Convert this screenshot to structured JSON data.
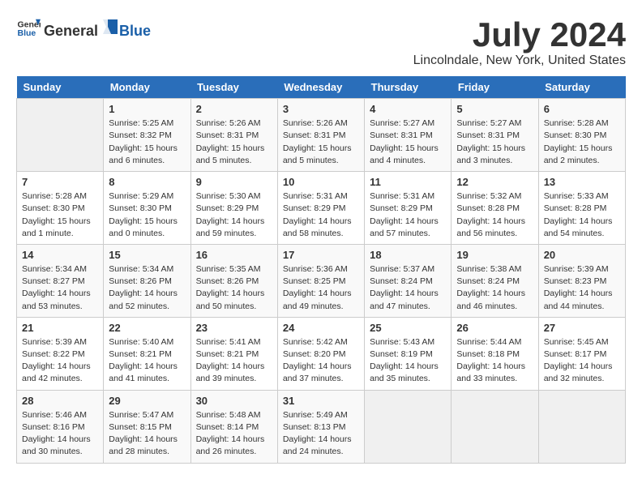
{
  "header": {
    "logo_general": "General",
    "logo_blue": "Blue",
    "main_title": "July 2024",
    "subtitle": "Lincolndale, New York, United States"
  },
  "days_of_week": [
    "Sunday",
    "Monday",
    "Tuesday",
    "Wednesday",
    "Thursday",
    "Friday",
    "Saturday"
  ],
  "weeks": [
    [
      {
        "day": "",
        "info": ""
      },
      {
        "day": "1",
        "info": "Sunrise: 5:25 AM\nSunset: 8:32 PM\nDaylight: 15 hours\nand 6 minutes."
      },
      {
        "day": "2",
        "info": "Sunrise: 5:26 AM\nSunset: 8:31 PM\nDaylight: 15 hours\nand 5 minutes."
      },
      {
        "day": "3",
        "info": "Sunrise: 5:26 AM\nSunset: 8:31 PM\nDaylight: 15 hours\nand 5 minutes."
      },
      {
        "day": "4",
        "info": "Sunrise: 5:27 AM\nSunset: 8:31 PM\nDaylight: 15 hours\nand 4 minutes."
      },
      {
        "day": "5",
        "info": "Sunrise: 5:27 AM\nSunset: 8:31 PM\nDaylight: 15 hours\nand 3 minutes."
      },
      {
        "day": "6",
        "info": "Sunrise: 5:28 AM\nSunset: 8:30 PM\nDaylight: 15 hours\nand 2 minutes."
      }
    ],
    [
      {
        "day": "7",
        "info": "Sunrise: 5:28 AM\nSunset: 8:30 PM\nDaylight: 15 hours\nand 1 minute."
      },
      {
        "day": "8",
        "info": "Sunrise: 5:29 AM\nSunset: 8:30 PM\nDaylight: 15 hours\nand 0 minutes."
      },
      {
        "day": "9",
        "info": "Sunrise: 5:30 AM\nSunset: 8:29 PM\nDaylight: 14 hours\nand 59 minutes."
      },
      {
        "day": "10",
        "info": "Sunrise: 5:31 AM\nSunset: 8:29 PM\nDaylight: 14 hours\nand 58 minutes."
      },
      {
        "day": "11",
        "info": "Sunrise: 5:31 AM\nSunset: 8:29 PM\nDaylight: 14 hours\nand 57 minutes."
      },
      {
        "day": "12",
        "info": "Sunrise: 5:32 AM\nSunset: 8:28 PM\nDaylight: 14 hours\nand 56 minutes."
      },
      {
        "day": "13",
        "info": "Sunrise: 5:33 AM\nSunset: 8:28 PM\nDaylight: 14 hours\nand 54 minutes."
      }
    ],
    [
      {
        "day": "14",
        "info": "Sunrise: 5:34 AM\nSunset: 8:27 PM\nDaylight: 14 hours\nand 53 minutes."
      },
      {
        "day": "15",
        "info": "Sunrise: 5:34 AM\nSunset: 8:26 PM\nDaylight: 14 hours\nand 52 minutes."
      },
      {
        "day": "16",
        "info": "Sunrise: 5:35 AM\nSunset: 8:26 PM\nDaylight: 14 hours\nand 50 minutes."
      },
      {
        "day": "17",
        "info": "Sunrise: 5:36 AM\nSunset: 8:25 PM\nDaylight: 14 hours\nand 49 minutes."
      },
      {
        "day": "18",
        "info": "Sunrise: 5:37 AM\nSunset: 8:24 PM\nDaylight: 14 hours\nand 47 minutes."
      },
      {
        "day": "19",
        "info": "Sunrise: 5:38 AM\nSunset: 8:24 PM\nDaylight: 14 hours\nand 46 minutes."
      },
      {
        "day": "20",
        "info": "Sunrise: 5:39 AM\nSunset: 8:23 PM\nDaylight: 14 hours\nand 44 minutes."
      }
    ],
    [
      {
        "day": "21",
        "info": "Sunrise: 5:39 AM\nSunset: 8:22 PM\nDaylight: 14 hours\nand 42 minutes."
      },
      {
        "day": "22",
        "info": "Sunrise: 5:40 AM\nSunset: 8:21 PM\nDaylight: 14 hours\nand 41 minutes."
      },
      {
        "day": "23",
        "info": "Sunrise: 5:41 AM\nSunset: 8:21 PM\nDaylight: 14 hours\nand 39 minutes."
      },
      {
        "day": "24",
        "info": "Sunrise: 5:42 AM\nSunset: 8:20 PM\nDaylight: 14 hours\nand 37 minutes."
      },
      {
        "day": "25",
        "info": "Sunrise: 5:43 AM\nSunset: 8:19 PM\nDaylight: 14 hours\nand 35 minutes."
      },
      {
        "day": "26",
        "info": "Sunrise: 5:44 AM\nSunset: 8:18 PM\nDaylight: 14 hours\nand 33 minutes."
      },
      {
        "day": "27",
        "info": "Sunrise: 5:45 AM\nSunset: 8:17 PM\nDaylight: 14 hours\nand 32 minutes."
      }
    ],
    [
      {
        "day": "28",
        "info": "Sunrise: 5:46 AM\nSunset: 8:16 PM\nDaylight: 14 hours\nand 30 minutes."
      },
      {
        "day": "29",
        "info": "Sunrise: 5:47 AM\nSunset: 8:15 PM\nDaylight: 14 hours\nand 28 minutes."
      },
      {
        "day": "30",
        "info": "Sunrise: 5:48 AM\nSunset: 8:14 PM\nDaylight: 14 hours\nand 26 minutes."
      },
      {
        "day": "31",
        "info": "Sunrise: 5:49 AM\nSunset: 8:13 PM\nDaylight: 14 hours\nand 24 minutes."
      },
      {
        "day": "",
        "info": ""
      },
      {
        "day": "",
        "info": ""
      },
      {
        "day": "",
        "info": ""
      }
    ]
  ]
}
